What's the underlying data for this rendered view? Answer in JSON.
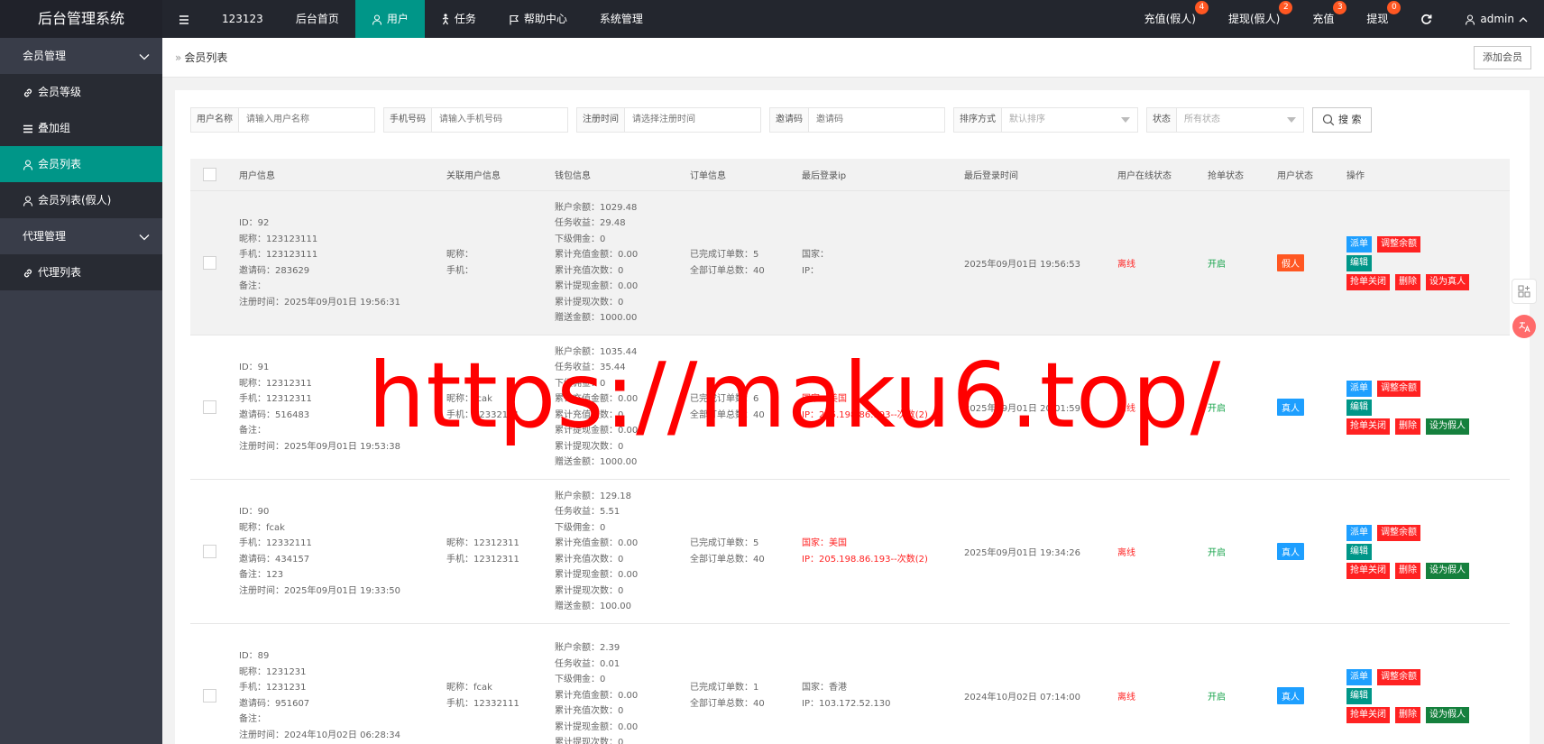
{
  "brand": "后台管理系统",
  "topnav": [
    {
      "label": "123123",
      "icon": ""
    },
    {
      "label": "后台首页",
      "icon": ""
    },
    {
      "label": "用户",
      "icon": "user-icon",
      "active": true
    },
    {
      "label": "任务",
      "icon": "person-icon"
    },
    {
      "label": "帮助中心",
      "icon": "flag-icon"
    },
    {
      "label": "系统管理",
      "icon": ""
    }
  ],
  "topright": [
    {
      "label": "充值(假人)",
      "badge": "4"
    },
    {
      "label": "提现(假人)",
      "badge": "2"
    },
    {
      "label": "充值",
      "badge": "3"
    },
    {
      "label": "提现",
      "badge": "0"
    }
  ],
  "admin": "admin",
  "sidebar": {
    "group1": "会员管理",
    "items1": [
      {
        "label": "会员等级",
        "icon": "link-icon"
      },
      {
        "label": "叠加组",
        "icon": "list-icon"
      },
      {
        "label": "会员列表",
        "icon": "user-icon",
        "active": true
      },
      {
        "label": "会员列表(假人)",
        "icon": "user-icon"
      }
    ],
    "group2": "代理管理",
    "items2": [
      {
        "label": "代理列表",
        "icon": "link-icon"
      }
    ]
  },
  "breadcrumb": "会员列表",
  "add_button": "添加会员",
  "filters": {
    "username": {
      "label": "用户名称",
      "placeholder": "请输入用户名称"
    },
    "phone": {
      "label": "手机号码",
      "placeholder": "请输入手机号码"
    },
    "regtime": {
      "label": "注册时间",
      "placeholder": "请选择注册时间"
    },
    "invite": {
      "label": "邀请码",
      "placeholder": "邀请码"
    },
    "sort": {
      "label": "排序方式",
      "value": "默认排序"
    },
    "status": {
      "label": "状态",
      "value": "所有状态"
    },
    "search": "搜 索"
  },
  "columns": [
    "用户信息",
    "关联用户信息",
    "钱包信息",
    "订单信息",
    "最后登录ip",
    "最后登录时间",
    "用户在线状态",
    "抢单状态",
    "用户状态",
    "操作"
  ],
  "rows": [
    {
      "user": [
        "ID：92",
        "昵称：123123111",
        "手机：123123111",
        "邀请码：283629",
        "备注：",
        "注册时间：2025年09月01日 19:56:31"
      ],
      "related": [
        "昵称：",
        "手机："
      ],
      "wallet": [
        "账户余额：1029.48",
        "任务收益：29.48",
        "下级佣金：0",
        "累计充值金额：0.00",
        "累计充值次数：0",
        "累计提现金额：0.00",
        "累计提现次数：0",
        "赠送金额：1000.00"
      ],
      "orders": [
        "已完成订单数：5",
        "全部订单总数：40"
      ],
      "ip": [
        "国家：",
        "IP："
      ],
      "ip_red": false,
      "last_login": "2025年09月01日 19:56:53",
      "online": "离线",
      "grab": "开启",
      "status": "假人",
      "status_kind": "fake",
      "toggle": "设为真人"
    },
    {
      "user": [
        "ID：91",
        "昵称：12312311",
        "手机：12312311",
        "邀请码：516483",
        "备注：",
        "注册时间：2025年09月01日 19:53:38"
      ],
      "related": [
        "昵称：fcak",
        "手机：12332111"
      ],
      "wallet": [
        "账户余额：1035.44",
        "任务收益：35.44",
        "下级佣金：0",
        "累计充值金额：0.00",
        "累计充值次数：0",
        "累计提现金额：0.00",
        "累计提现次数：0",
        "赠送金额：1000.00"
      ],
      "orders": [
        "已完成订单数：6",
        "全部订单总数：40"
      ],
      "ip": [
        "国家：美国",
        "IP：205.198.86.193--次数(2)"
      ],
      "ip_red": true,
      "last_login": "2025年09月01日 20:01:59",
      "online": "离线",
      "grab": "开启",
      "status": "真人",
      "status_kind": "real",
      "toggle": "设为假人"
    },
    {
      "user": [
        "ID：90",
        "昵称：fcak",
        "手机：12332111",
        "邀请码：434157",
        "备注：123",
        "注册时间：2025年09月01日 19:33:50"
      ],
      "related": [
        "昵称：12312311",
        "手机：12312311"
      ],
      "wallet": [
        "账户余额：129.18",
        "任务收益：5.51",
        "下级佣金：0",
        "累计充值金额：0.00",
        "累计充值次数：0",
        "累计提现金额：0.00",
        "累计提现次数：0",
        "赠送金额：100.00"
      ],
      "orders": [
        "已完成订单数：5",
        "全部订单总数：40"
      ],
      "ip": [
        "国家：美国",
        "IP：205.198.86.193--次数(2)"
      ],
      "ip_red": true,
      "last_login": "2025年09月01日 19:34:26",
      "online": "离线",
      "grab": "开启",
      "status": "真人",
      "status_kind": "real",
      "toggle": "设为假人"
    },
    {
      "user": [
        "ID：89",
        "昵称：1231231",
        "手机：1231231",
        "邀请码：951607",
        "备注：",
        "注册时间：2024年10月02日 06:28:34"
      ],
      "related": [
        "昵称：fcak",
        "手机：12332111"
      ],
      "wallet": [
        "账户余额：2.39",
        "任务收益：0.01",
        "下级佣金：0",
        "累计充值金额：0.00",
        "累计充值次数：0",
        "累计提现金额：0.00",
        "累计提现次数：0"
      ],
      "orders": [
        "已完成订单数：1",
        "全部订单总数：40"
      ],
      "ip": [
        "国家：香港",
        "IP：103.172.52.130"
      ],
      "ip_red": false,
      "last_login": "2024年10月02日 07:14:00",
      "online": "离线",
      "grab": "开启",
      "status": "真人",
      "status_kind": "real",
      "toggle": "设为假人"
    }
  ],
  "actions": {
    "dispatch": "派单",
    "adjust": "调整余额",
    "edit": "编辑",
    "grab_off": "抢单关闭",
    "delete": "删除"
  },
  "watermark": "https://maku6.top/",
  "colors": {
    "topbar": "#23262e",
    "sidebar": "#393d49",
    "accent": "#009688",
    "danger": "#ff2222",
    "info": "#1e9fff"
  }
}
